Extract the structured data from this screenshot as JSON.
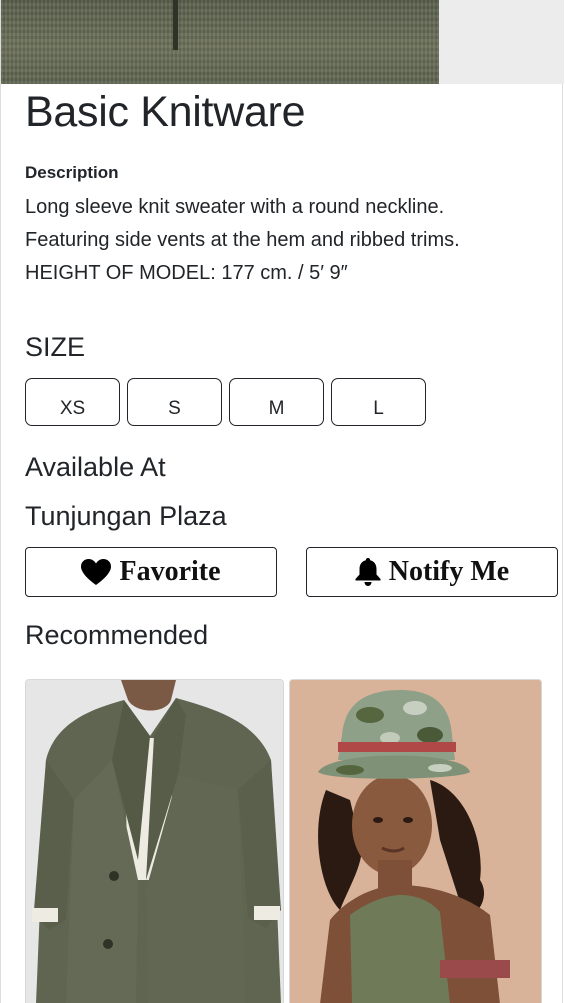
{
  "product": {
    "title": "Basic Knitware",
    "description_label": "Description",
    "description_lines": [
      "Long sleeve knit sweater with a round neckline.",
      "Featuring side vents at the hem and ribbed trims.",
      "HEIGHT OF MODEL: 177 cm. / 5′ 9″"
    ],
    "hero_image_alt": "knitwear-fabric-photo"
  },
  "size": {
    "label": "SIZE",
    "options": [
      "XS",
      "S",
      "M",
      "L"
    ]
  },
  "availability": {
    "label": "Available At",
    "store": "Tunjungan Plaza"
  },
  "actions": {
    "favorite_label": "Favorite",
    "favorite_icon": "heart-icon",
    "notify_label": "Notify Me",
    "notify_icon": "bell-icon"
  },
  "recommended": {
    "label": "Recommended",
    "items": [
      {
        "image": "green-linen-blazer-photo"
      },
      {
        "image": "camo-bucket-hat-model-photo"
      }
    ]
  },
  "colors": {
    "text": "#212529",
    "border": "#212529",
    "background": "#ffffff"
  }
}
